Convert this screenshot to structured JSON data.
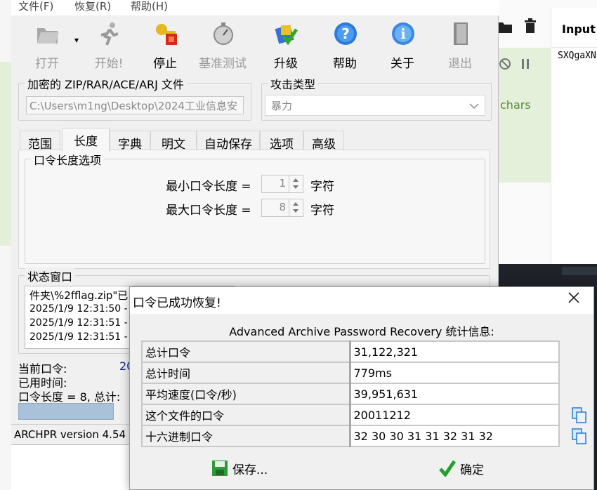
{
  "background": {
    "right_header": "Input",
    "right_value": "SXQgaXN",
    "right_green_text": "chars"
  },
  "menu": [
    "文件(F)",
    "恢复(R)",
    "帮助(H)"
  ],
  "toolbar": {
    "open": "打开",
    "start": "开始!",
    "stop": "停止",
    "benchmark": "基准测试",
    "upgrade": "升级",
    "help": "帮助",
    "about": "关于",
    "exit": "退出"
  },
  "file_group": {
    "title": "加密的 ZIP/RAR/ACE/ARJ 文件",
    "path": "C:\\Users\\m1ng\\Desktop\\2024工业信息安"
  },
  "attack_group": {
    "title": "攻击类型",
    "selected": "暴力"
  },
  "tabs": [
    "范围",
    "长度",
    "字典",
    "明文",
    "自动保存",
    "选项",
    "高级"
  ],
  "length_panel": {
    "title": "口令长度选项",
    "min_label": "最小口令长度 =",
    "min_value": "1",
    "max_label": "最大口令长度 =",
    "max_value": "8",
    "unit": "字符"
  },
  "status": {
    "title": "状态窗口",
    "log": [
      "件夹\\%2fflag.zip\"已",
      "2025/1/9 12:31:50 -",
      "2025/1/9 12:31:51 -",
      "2025/1/9 12:31:51 -"
    ],
    "current_password_label": "当前口令:",
    "current_password_value": "20",
    "elapsed_label": "已用时间:",
    "length_total": "口令长度 = 8, 总计:"
  },
  "statusbar": "ARCHPR version 4.54 (",
  "dialog": {
    "title": "口令已成功恢复!",
    "heading": "Advanced Archive Password Recovery 统计信息:",
    "rows": [
      {
        "key": "总计口令",
        "value": "31,122,321"
      },
      {
        "key": "总计时间",
        "value": "779ms"
      },
      {
        "key": "平均速度(口令/秒)",
        "value": "39,951,631"
      },
      {
        "key": "这个文件的口令",
        "value": "20011212"
      },
      {
        "key": "十六进制口令",
        "value": "32 30 30 31 31 32 31 32"
      }
    ],
    "save": "保存...",
    "ok": "确定"
  }
}
